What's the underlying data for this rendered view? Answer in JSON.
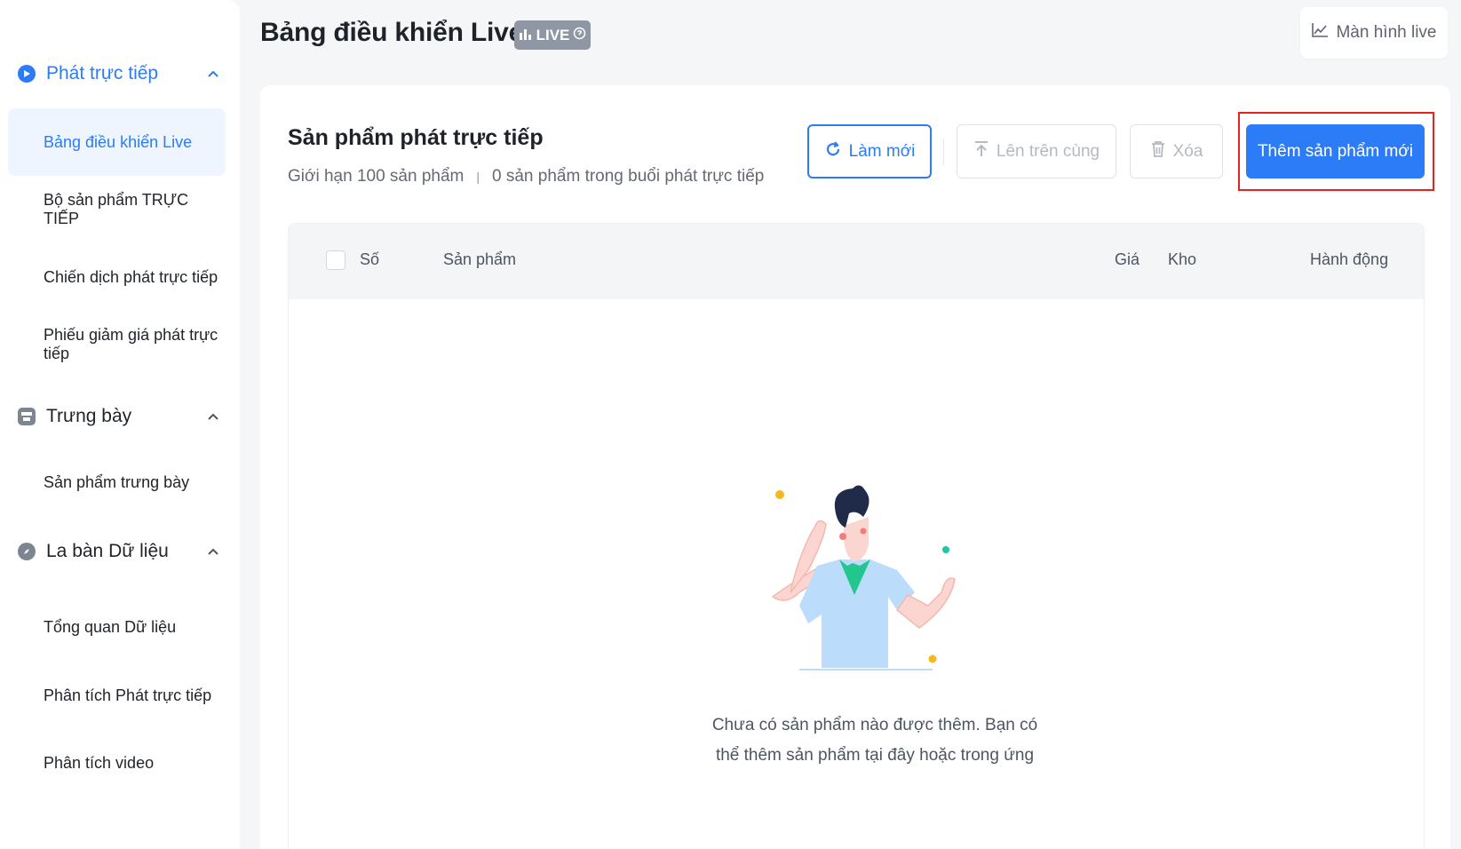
{
  "sidebar": {
    "sections": [
      {
        "label": "Phát trực tiếp",
        "icon": "play-circle-icon",
        "items": [
          "Bảng điều khiển Live",
          "Bộ sản phẩm TRỰC TIẾP",
          "Chiến dịch phát trực tiếp",
          "Phiếu giảm giá phát trực tiếp"
        ]
      },
      {
        "label": "Trưng bày",
        "icon": "storefront-icon",
        "items": [
          "Sản phẩm trưng bày"
        ]
      },
      {
        "label": "La bàn Dữ liệu",
        "icon": "compass-icon",
        "items": [
          "Tổng quan Dữ liệu",
          "Phân tích Phát trực tiếp",
          "Phân tích video"
        ]
      }
    ],
    "active_item": "Bảng điều khiển Live"
  },
  "header": {
    "title": "Bảng điều khiển Live",
    "badge": "LIVE",
    "monitor_button": "Màn hình live"
  },
  "card": {
    "title": "Sản phẩm phát trực tiếp",
    "limit_text": "Giới hạn 100 sản phẩm",
    "count_text": "0 sản phẩm trong buổi phát trực tiếp",
    "buttons": {
      "refresh": "Làm mới",
      "pin_top": "Lên trên cùng",
      "delete": "Xóa",
      "add": "Thêm sản phẩm mới"
    },
    "table": {
      "columns": [
        "Số",
        "Sản phẩm",
        "Giá",
        "Kho",
        "Hành động"
      ]
    },
    "empty_message_line1": "Chưa có sản phẩm nào được thêm. Bạn có",
    "empty_message_line2": "thể thêm sản phẩm tại đây hoặc trong ứng"
  },
  "colors": {
    "accent": "#2b7cf6",
    "active_bg": "#eef5ff",
    "highlight_border": "#e5221f",
    "badge_bg": "#8f97a4"
  }
}
